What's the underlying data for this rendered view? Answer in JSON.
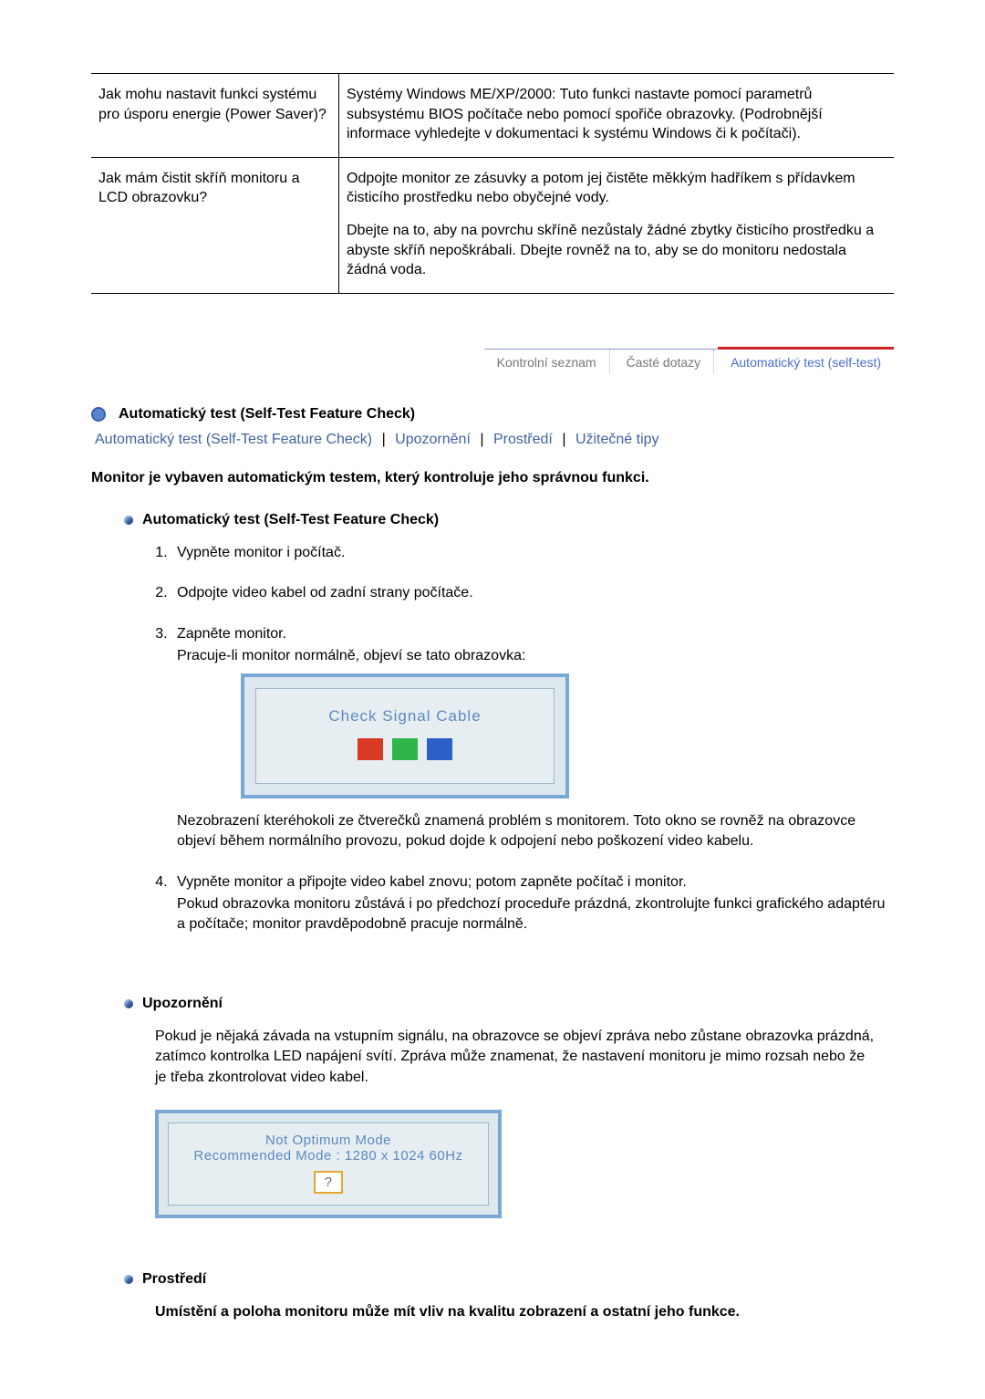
{
  "qna": [
    {
      "q": "Jak mohu nastavit funkci systému pro úsporu energie (Power Saver)?",
      "a": [
        "Systémy Windows ME/XP/2000: Tuto funkci nastavte pomocí parametrů subsystému BIOS počítače nebo pomocí spořiče obrazovky. (Podrobnější informace vyhledejte v dokumentaci k systému Windows či k počítači)."
      ]
    },
    {
      "q": "Jak mám čistit skříň monitoru a LCD obrazovku?",
      "a": [
        "Odpojte monitor ze zásuvky a potom jej čistěte měkkým hadříkem s přídavkem čisticího prostředku nebo obyčejné vody.",
        "Dbejte na to, aby na povrchu skříně nezůstaly žádné zbytky čisticího prostředku a abyste skříň nepoškrábali. Dbejte rovněž na to, aby se do monitoru nedostala žádná voda."
      ]
    }
  ],
  "tabs": {
    "t1": "Kontrolní seznam",
    "t2": "Časté dotazy",
    "t3": "Automatický test (self-test)"
  },
  "title": "Automatický test (Self-Test Feature Check)",
  "nav": {
    "l1": "Automatický test (Self-Test Feature Check)",
    "l2": "Upozornění",
    "l3": "Prostředí",
    "l4": "Užitečné tipy"
  },
  "intro": "Monitor je vybaven automatickým testem, který kontroluje jeho správnou funkci.",
  "sec1": {
    "heading": "Automatický test (Self-Test Feature Check)",
    "s1": "Vypněte monitor i počítač.",
    "s2": "Odpojte video kabel od zadní strany počítače.",
    "s3a": "Zapněte monitor.",
    "s3b": "Pracuje-li monitor normálně, objeví se tato obrazovka:",
    "shot1": "Check Signal Cable",
    "after1": "Nezobrazení kteréhokoli ze čtverečků znamená problém s monitorem. Toto okno se rovněž na obrazovce objeví během normálního provozu, pokud dojde k odpojení nebo poškození video kabelu.",
    "s4a": "Vypněte monitor a připojte video kabel znovu; potom zapněte počítač i monitor.",
    "s4b": "Pokud obrazovka monitoru zůstává i po předchozí proceduře prázdná, zkontrolujte funkci grafického adaptéru a počítače; monitor pravděpodobně pracuje normálně."
  },
  "sec2": {
    "heading": "Upozornění",
    "body": "Pokud je nějaká závada na vstupním signálu, na obrazovce se objeví zpráva nebo zůstane obrazovka prázdná, zatímco kontrolka LED napájení svítí. Zpráva může znamenat, že nastavení monitoru je mimo rozsah nebo že je třeba zkontrolovat video kabel.",
    "shot_l1": "Not Optimum Mode",
    "shot_l2": "Recommended Mode : 1280 x 1024  60Hz",
    "qmark": "?"
  },
  "sec3": {
    "heading": "Prostředí",
    "body": "Umístění a poloha monitoru může mít vliv na kvalitu zobrazení a ostatní jeho funkce."
  }
}
